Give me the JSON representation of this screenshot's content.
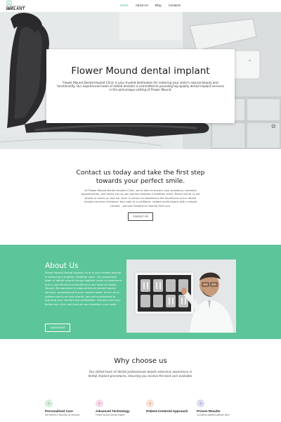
{
  "nav": {
    "logo_small": "FLOWER MOUND DENTAL",
    "logo_big": "IMPLANT",
    "items": [
      {
        "label": "Home",
        "active": true
      },
      {
        "label": "About Us",
        "active": false
      },
      {
        "label": "Blog",
        "active": false
      },
      {
        "label": "Contacts",
        "active": false
      }
    ]
  },
  "hero": {
    "title": "Flower Mound dental implant",
    "text": "Flower Mound Dental Implant Clinic is your trusted destination for restoring your smile's natural beauty and functionality. Our experienced team of skilled dentists is committed to providing top-quality dental implant services in the picturesque setting of Flower Mound."
  },
  "contact": {
    "title": "Contact us today and take the first step towards your perfect smile.",
    "text": "At Flower Mound Dental Implant Clinic, we're here to answer your questions, schedule appointments, and assist you as you journey towards a healthier smile. Reach out to us via phone or email, or visit our clinic in person to experience the excellence of our dental implant services firsthand. Your path to a confident, radiant smile begins with a simple contact – we look forward to hearing from you.",
    "button": "CONTACT US"
  },
  "about": {
    "title": "About Us",
    "text": "Flower Mound Dental Implant Clinic is your trusted partner in achieving a brighter, healthier smile. Our passionate team of dental experts brings together years of experience and a commitment to excellence in the heart of Flower Mound. We specialize in state-of-the-art dental implant services, personalized to your unique needs. At our clinic, patient care is our top priority, and we're dedicated to ensuring your comfort and satisfaction. Discover the story behind our clinic and how we can transform your smile.",
    "button": "LEARN MORE"
  },
  "why": {
    "title": "Why choose us",
    "text": "Our skilled team of dental professionals boasts extensive experience in dental implant procedures, ensuring you receive the best care available.",
    "features": [
      {
        "num": "1",
        "title": "Personalized Care",
        "text": "We believe in tailoring our services",
        "color": "#d3efd9"
      },
      {
        "num": "2",
        "title": "Advanced Technology",
        "text": "Flower Mound Dental Implant",
        "color": "#f6d9ec"
      },
      {
        "num": "3",
        "title": "Patient-Centered Approach",
        "text": "",
        "color": "#fbe0d3"
      },
      {
        "num": "4",
        "title": "Proven Results",
        "text": "Countless satisfied patients have",
        "color": "#dcdcf6"
      }
    ]
  },
  "colors": {
    "accent": "#47b98a",
    "about_bg": "#5cc59a"
  }
}
